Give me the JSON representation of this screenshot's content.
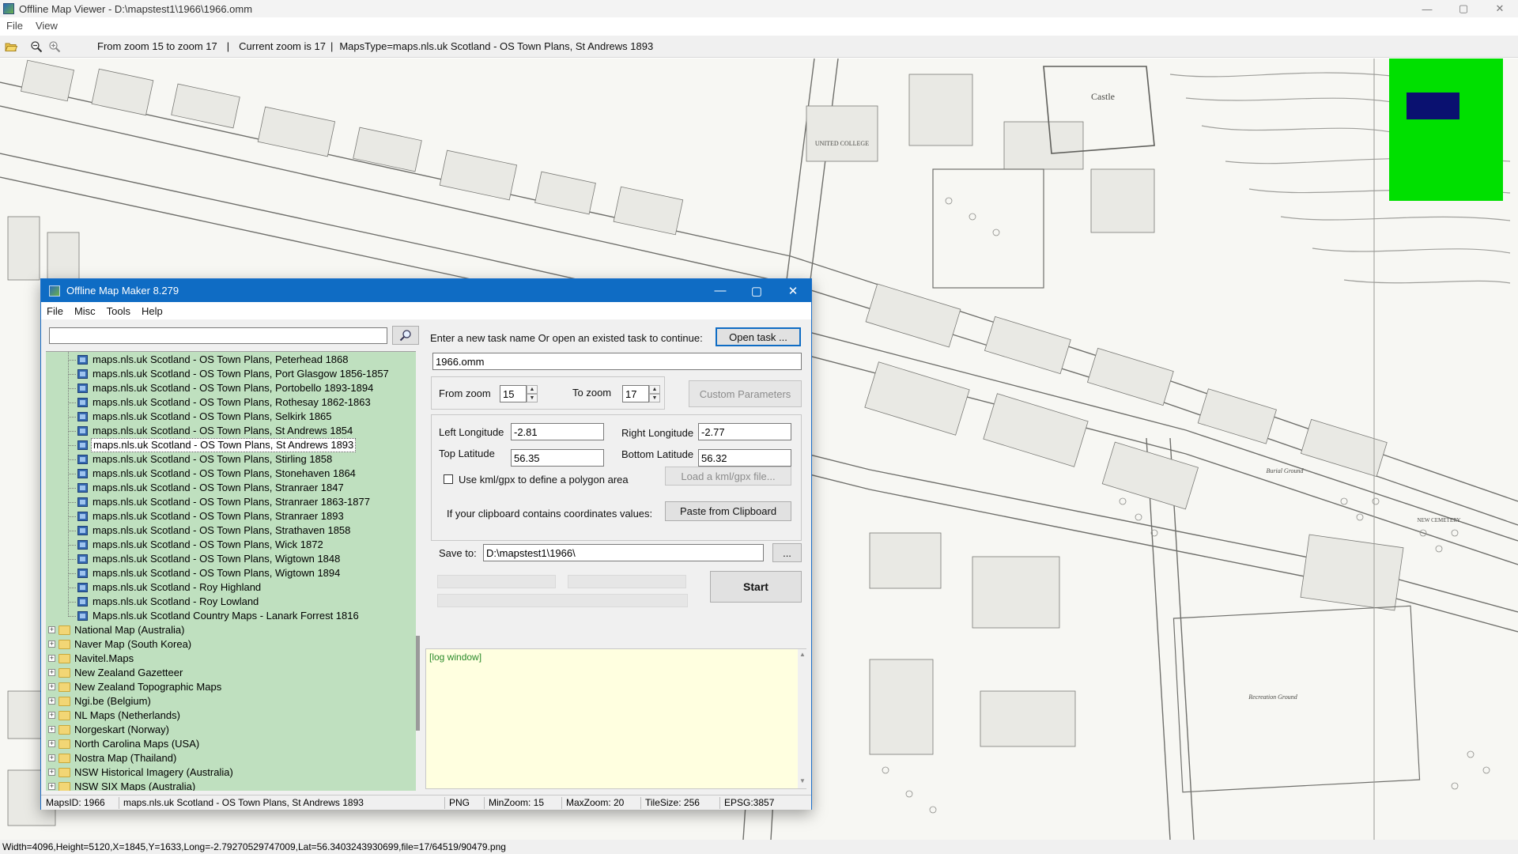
{
  "viewer": {
    "title": "Offline Map Viewer - D:\\mapstest1\\1966\\1966.omm",
    "menu": [
      "File",
      "View"
    ],
    "toolbar": {
      "zoom_range": "From zoom 15 to zoom 17",
      "current_zoom": "Current zoom is 17",
      "maps_type": "MapsType=maps.nls.uk Scotland - OS Town Plans, St Andrews 1893",
      "separator": "|"
    },
    "status": "Width=4096,Height=5120,X=1845,Y=1633,Long=-2.79270529747009,Lat=56.3403243930699,file=17/64519/90479.png",
    "window_controls": {
      "minimize": "—",
      "maximize": "▢",
      "close": "✕"
    },
    "map_labels": [
      "Castle",
      "UNITED COLLEGE",
      "Recreation Ground",
      "Burial Ground",
      "NEW CEMETERY"
    ]
  },
  "maker": {
    "title": "Offline Map Maker 8.279",
    "menu": [
      "File",
      "Misc",
      "Tools",
      "Help"
    ],
    "search_placeholder": "",
    "tree_children": [
      "maps.nls.uk Scotland - OS Town Plans, Peterhead 1868",
      "maps.nls.uk Scotland - OS Town Plans, Port Glasgow 1856-1857",
      "maps.nls.uk Scotland - OS Town Plans, Portobello 1893-1894",
      "maps.nls.uk Scotland - OS Town Plans, Rothesay 1862-1863",
      "maps.nls.uk Scotland - OS Town Plans, Selkirk 1865",
      "maps.nls.uk Scotland - OS Town Plans, St Andrews 1854",
      "maps.nls.uk Scotland - OS Town Plans, St Andrews 1893",
      "maps.nls.uk Scotland - OS Town Plans, Stirling 1858",
      "maps.nls.uk Scotland - OS Town Plans, Stonehaven 1864",
      "maps.nls.uk Scotland - OS Town Plans, Stranraer 1847",
      "maps.nls.uk Scotland - OS Town Plans, Stranraer 1863-1877",
      "maps.nls.uk Scotland - OS Town Plans, Stranraer 1893",
      "maps.nls.uk Scotland - OS Town Plans, Strathaven 1858",
      "maps.nls.uk Scotland - OS Town Plans, Wick 1872",
      "maps.nls.uk Scotland - OS Town Plans, Wigtown 1848",
      "maps.nls.uk Scotland - OS Town Plans, Wigtown 1894",
      "maps.nls.uk Scotland - Roy Highland",
      "maps.nls.uk Scotland - Roy Lowland",
      "Maps.nls.uk Scotland Country Maps - Lanark Forrest 1816"
    ],
    "selected_child": "maps.nls.uk Scotland - OS Town Plans, St Andrews 1893",
    "tree_folders": [
      "National Map (Australia)",
      "Naver Map (South Korea)",
      "Navitel.Maps",
      "New Zealand Gazetteer",
      "New Zealand Topographic Maps",
      "Ngi.be (Belgium)",
      "NL Maps (Netherlands)",
      "Norgeskart (Norway)",
      "North Carolina Maps (USA)",
      "Nostra Map (Thailand)",
      "NSW Historical Imagery (Australia)",
      "NSW SIX Maps (Australia)"
    ],
    "task_prompt": "Enter a new task name Or open an existed task to continue:",
    "open_task": "Open task ...",
    "task_name": "1966.omm",
    "from_zoom_label": "From zoom",
    "from_zoom": "15",
    "to_zoom_label": "To zoom",
    "to_zoom": "17",
    "custom_params": "Custom Parameters",
    "left_lon_label": "Left Longitude",
    "left_lon": "-2.81",
    "right_lon_label": "Right Longitude",
    "right_lon": "-2.77",
    "top_lat_label": "Top Latitude",
    "top_lat": "56.35",
    "bottom_lat_label": "Bottom Latitude",
    "bottom_lat": "56.32",
    "kml_label": "Use kml/gpx to define a polygon area",
    "kml_checked": false,
    "load_kml": "Load a kml/gpx file...",
    "clipboard_label": "If your clipboard contains coordinates values:",
    "paste_clipboard": "Paste from Clipboard",
    "save_to_label": "Save to:",
    "save_to": "D:\\mapstest1\\1966\\",
    "browse": "...",
    "start": "Start",
    "log": "[log window]",
    "status": {
      "maps_id": "MapsID: 1966",
      "map_name": "maps.nls.uk Scotland - OS Town Plans, St Andrews 1893",
      "format": "PNG",
      "min_zoom": "MinZoom: 15",
      "max_zoom": "MaxZoom: 20",
      "tile_size": "TileSize: 256",
      "epsg": "EPSG:3857"
    }
  },
  "colors": {
    "tree_background": "#bfe0bf",
    "overview_background": "#00e000",
    "overview_viewport": "#0a1170",
    "dialog_titlebar": "#0f6cc4",
    "log_background": "#ffffe0"
  }
}
